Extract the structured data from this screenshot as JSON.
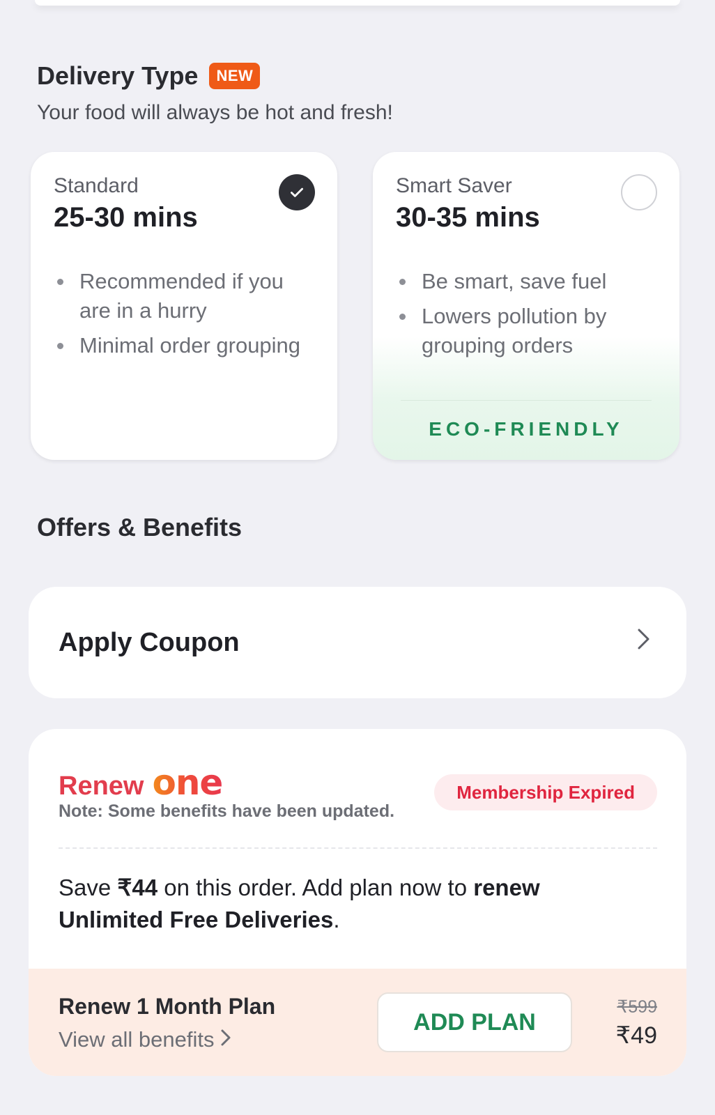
{
  "delivery": {
    "title": "Delivery Type",
    "badge": "NEW",
    "subtitle": "Your food will always be hot and fresh!",
    "options": [
      {
        "label": "Standard",
        "time": "25-30 mins",
        "selected": true,
        "bullets": [
          "Recommended if you are in a hurry",
          "Minimal order grouping"
        ]
      },
      {
        "label": "Smart Saver",
        "time": "30-35 mins",
        "selected": false,
        "bullets": [
          "Be smart, save fuel",
          "Lowers pollution by grouping orders"
        ],
        "tag": "ECO-FRIENDLY"
      }
    ]
  },
  "offers": {
    "title": "Offers & Benefits",
    "coupon_label": "Apply Coupon"
  },
  "renew": {
    "renew_word": "Renew",
    "brand": "one",
    "note": "Note: Some benefits have been updated.",
    "status": "Membership Expired",
    "save_prefix": "Save ",
    "save_amount": "₹44",
    "save_mid": " on this order. Add plan now to ",
    "save_bold1": "renew",
    "save_bold2": "Unlimited Free Deliveries",
    "save_suffix": ".",
    "plan_name": "Renew 1 Month Plan",
    "benefits_link": "View all benefits",
    "add_button": "ADD PLAN",
    "price_old": "₹599",
    "price_new": "₹49"
  },
  "colors": {
    "accent_green": "#1f8a55",
    "badge_orange": "#ef5a17",
    "expired_red": "#e0253f"
  },
  "icons": [
    "check-icon",
    "radio-empty-icon",
    "chevron-right-icon"
  ]
}
